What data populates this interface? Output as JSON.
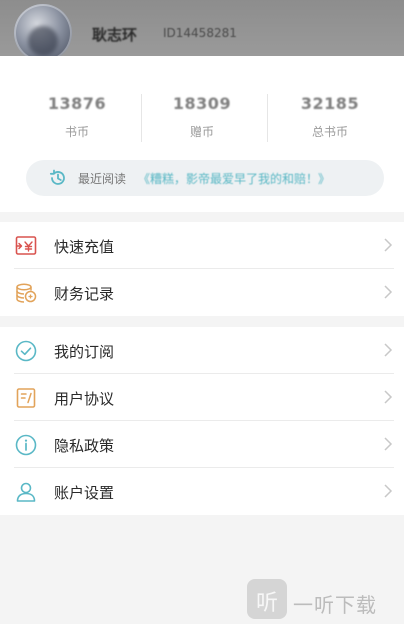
{
  "profile": {
    "username": "耿志环",
    "user_id": "ID14458281"
  },
  "stats": [
    {
      "value": "13876",
      "label": "书币"
    },
    {
      "value": "18309",
      "label": "赠币"
    },
    {
      "value": "32185",
      "label": "总书币"
    }
  ],
  "recent": {
    "label": "最近阅读",
    "book": "《糟糕，影帝最爱早了我的和赔！》"
  },
  "menu_group1": [
    {
      "label": "快速充值",
      "icon": "recharge-icon"
    },
    {
      "label": "财务记录",
      "icon": "finance-coins-icon"
    }
  ],
  "menu_group2": [
    {
      "label": "我的订阅",
      "icon": "subscription-check-icon"
    },
    {
      "label": "用户协议",
      "icon": "agreement-doc-icon"
    },
    {
      "label": "隐私政策",
      "icon": "info-icon"
    },
    {
      "label": "账户设置",
      "icon": "user-icon"
    }
  ],
  "watermark": {
    "icon_glyph": "听",
    "text": "一听下载"
  },
  "colors": {
    "header_bg": "#8d8d8d",
    "accent_teal": "#58b7c4",
    "recharge_red": "#d9534f",
    "finance_orange": "#e2a35a",
    "teal_icon": "#5ab8c6"
  }
}
